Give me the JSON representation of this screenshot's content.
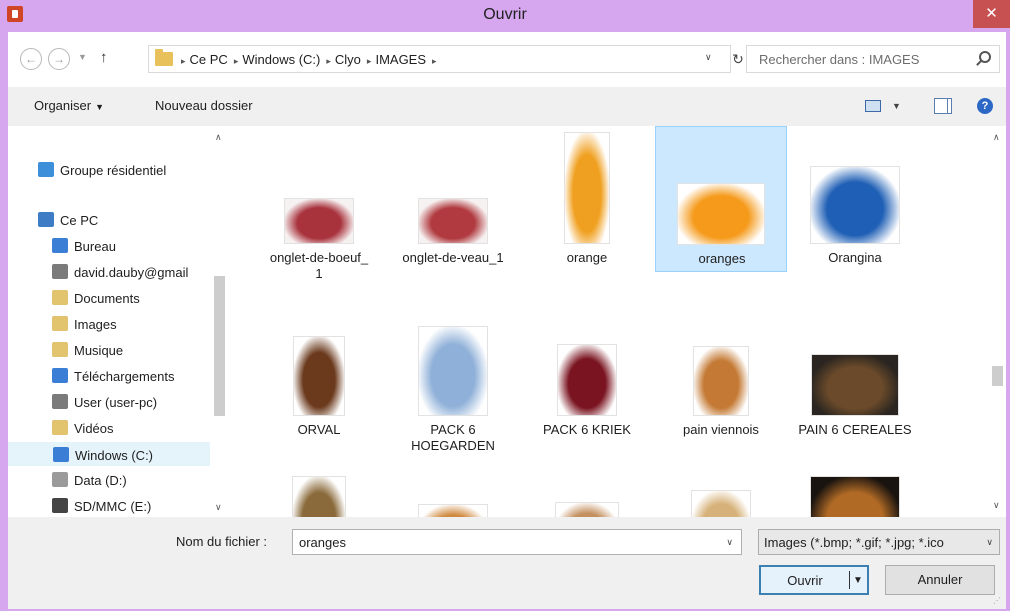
{
  "window": {
    "title": "Ouvrir",
    "close_glyph": "✕"
  },
  "address": {
    "crumbs": [
      "Ce PC",
      "Windows (C:)",
      "Clyo",
      "IMAGES"
    ],
    "separator": "▸"
  },
  "search": {
    "placeholder": "Rechercher dans : IMAGES"
  },
  "toolbar": {
    "organize_label": "Organiser",
    "new_folder_label": "Nouveau dossier",
    "help_glyph": "?"
  },
  "nav": {
    "items": [
      {
        "label": "Groupe résidentiel",
        "icon": "homegroup-icon",
        "color": "#3c8fd8"
      },
      {
        "label": "Ce PC",
        "icon": "computer-icon",
        "color": "#3e7cc5"
      },
      {
        "label": "Bureau",
        "icon": "desktop-folder-icon",
        "color": "#3b7ed6"
      },
      {
        "label": "david.dauby@gmail",
        "icon": "user-folder-icon",
        "color": "#7b7b7b"
      },
      {
        "label": "Documents",
        "icon": "documents-folder-icon",
        "color": "#e2c36e"
      },
      {
        "label": "Images",
        "icon": "pictures-folder-icon",
        "color": "#e2c36e"
      },
      {
        "label": "Musique",
        "icon": "music-folder-icon",
        "color": "#e2c36e"
      },
      {
        "label": "Téléchargements",
        "icon": "downloads-folder-icon",
        "color": "#3b7ed6"
      },
      {
        "label": "User (user-pc)",
        "icon": "network-user-icon",
        "color": "#7b7b7b"
      },
      {
        "label": "Vidéos",
        "icon": "videos-folder-icon",
        "color": "#e2c36e"
      },
      {
        "label": "Windows (C:)",
        "icon": "drive-c-icon",
        "color": "#3b7ed6"
      },
      {
        "label": "Data (D:)",
        "icon": "drive-d-icon",
        "color": "#9a9a9a"
      },
      {
        "label": "SD/MMC (E:)",
        "icon": "sd-card-icon",
        "color": "#444444"
      }
    ],
    "selected": "Windows (C:)"
  },
  "files": [
    {
      "name": "onglet-de-boeuf_\n1",
      "color": "#a8333d",
      "bg": "#f7f2f2"
    },
    {
      "name": "onglet-de-veau_1",
      "color": "#b03a3f",
      "bg": "#f7f2f2"
    },
    {
      "name": "orange",
      "color": "#f0a020",
      "bg": "#ffffff"
    },
    {
      "name": "oranges",
      "color": "#f59a1a",
      "bg": "#ffffff"
    },
    {
      "name": "Orangina",
      "color": "#1f5fb5",
      "bg": "#ffffff"
    },
    {
      "name": "ORVAL",
      "color": "#6b3a1d",
      "bg": "#ffffff"
    },
    {
      "name": "PACK 6\nHOEGARDEN",
      "color": "#8fb0d8",
      "bg": "#ffffff"
    },
    {
      "name": "PACK 6 KRIEK",
      "color": "#7a1420",
      "bg": "#ffffff"
    },
    {
      "name": "pain  viennois",
      "color": "#c47a35",
      "bg": "#ffffff"
    },
    {
      "name": "PAIN 6 CEREALES",
      "color": "#6a4a2a",
      "bg": "#2a2520"
    },
    {
      "name": "",
      "color": "#8a6a3a",
      "bg": "#ffffff"
    },
    {
      "name": "",
      "color": "#d08a40",
      "bg": "#ffffff"
    },
    {
      "name": "",
      "color": "#c49060",
      "bg": "#ffffff"
    },
    {
      "name": "",
      "color": "#d6b27a",
      "bg": "#ffffff"
    },
    {
      "name": "",
      "color": "#b06a25",
      "bg": "#1a1410"
    }
  ],
  "selected_file": "oranges",
  "footer": {
    "filename_label": "Nom du fichier :",
    "filename_value": "oranges",
    "filetype_value": "Images (*.bmp; *.gif; *.jpg; *.ico",
    "open_label": "Ouvrir",
    "cancel_label": "Annuler"
  }
}
